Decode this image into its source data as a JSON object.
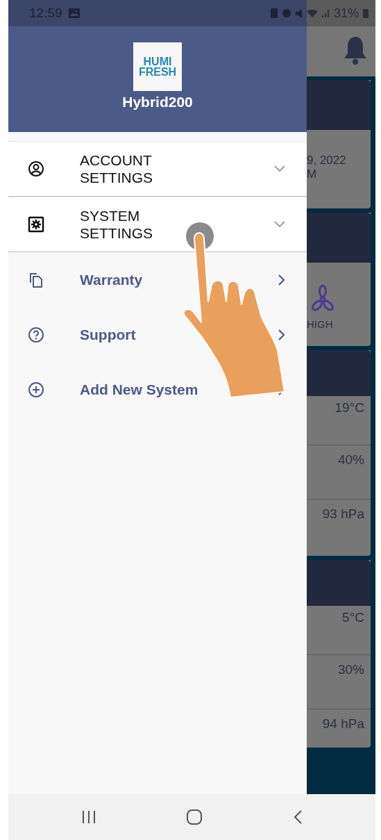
{
  "status_bar": {
    "time": "12:59",
    "battery": "31%"
  },
  "drawer": {
    "logo": {
      "lines": [
        "HUMI",
        "FRESH"
      ]
    },
    "device_name": "Hybrid200",
    "menu": [
      {
        "kind": "expandable",
        "label": "ACCOUNT SETTINGS",
        "expanded": false
      },
      {
        "kind": "expandable",
        "label": "SYSTEM SETTINGS",
        "expanded": false
      },
      {
        "kind": "link",
        "label": "Warranty"
      },
      {
        "kind": "link",
        "label": "Support"
      },
      {
        "kind": "link",
        "label": "Add New System"
      }
    ]
  },
  "background": {
    "cards": [
      {
        "kind": "date",
        "lines": [
          "9, 2022",
          "M"
        ]
      },
      {
        "kind": "fan",
        "label": "HIGH"
      },
      {
        "kind": "readings",
        "values": [
          "19°C",
          "40%",
          "93 hPa"
        ]
      },
      {
        "kind": "readings",
        "values": [
          "5°C",
          "30%",
          "94 hPa"
        ]
      }
    ]
  }
}
